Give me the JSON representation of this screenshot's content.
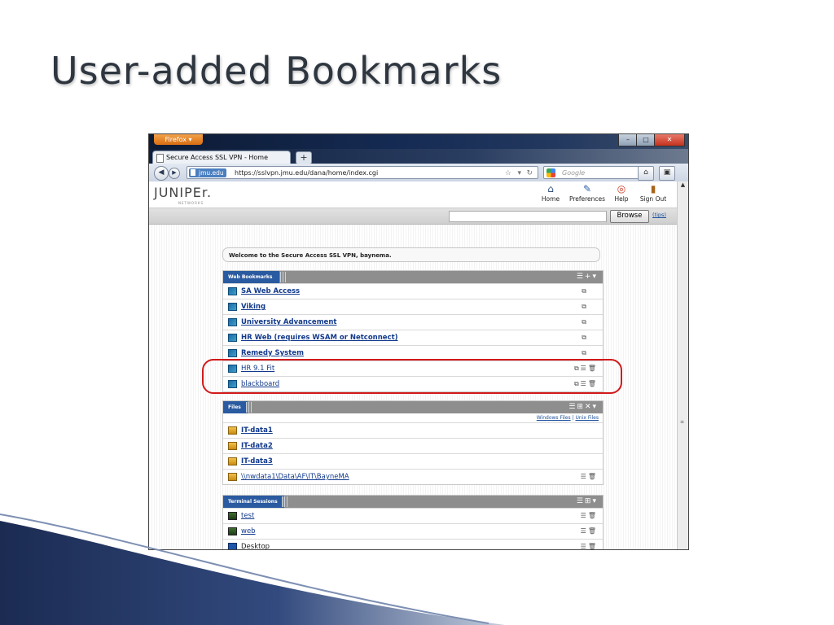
{
  "slide": {
    "title": "User-added Bookmarks"
  },
  "browser": {
    "menu_button": "Firefox ▾",
    "window_controls": {
      "minimize": "–",
      "maximize": "□",
      "close": "✕"
    },
    "tab_title": "Secure Access SSL VPN - Home",
    "new_tab": "+",
    "site_identity": "jmu.edu",
    "url": "https://sslvpn.jmu.edu/dana/home/index.cgi",
    "search_placeholder": "Google"
  },
  "portal": {
    "logo": "JUNIPEr.",
    "logo_sub": "NETWORKS",
    "nav": [
      {
        "label": "Home",
        "icon": "home-icon"
      },
      {
        "label": "Preferences",
        "icon": "wrench-icon"
      },
      {
        "label": "Help",
        "icon": "lifebuoy-icon"
      },
      {
        "label": "Sign Out",
        "icon": "door-icon"
      }
    ],
    "browse_label": "Browse",
    "tips_label": "(tips)",
    "welcome": "Welcome to the Secure Access SSL VPN, baynema."
  },
  "web_bookmarks": {
    "title": "Web Bookmarks",
    "items": [
      {
        "label": "SA Web Access",
        "bold": true
      },
      {
        "label": "Viking",
        "bold": true
      },
      {
        "label": "University Advancement",
        "bold": true
      },
      {
        "label": "HR Web (requires WSAM or Netconnect)",
        "bold": true
      },
      {
        "label": "Remedy System",
        "bold": true
      },
      {
        "label": "HR 9.1 Fit",
        "bold": false
      },
      {
        "label": "blackboard",
        "bold": false
      }
    ]
  },
  "files": {
    "title": "Files",
    "windows_files": "Windows Files",
    "separator": "|",
    "unix_files": "Unix Files",
    "items": [
      {
        "label": "IT-data1",
        "bold": true
      },
      {
        "label": "IT-data2",
        "bold": true
      },
      {
        "label": "IT-data3",
        "bold": true
      },
      {
        "label": "\\\\nwdata1\\Data\\AF\\IT\\BayneMA",
        "bold": false
      }
    ]
  },
  "terminal_sessions": {
    "title": "Terminal Sessions",
    "items": [
      {
        "label": "test"
      },
      {
        "label": "web"
      },
      {
        "label": "Desktop"
      }
    ]
  }
}
